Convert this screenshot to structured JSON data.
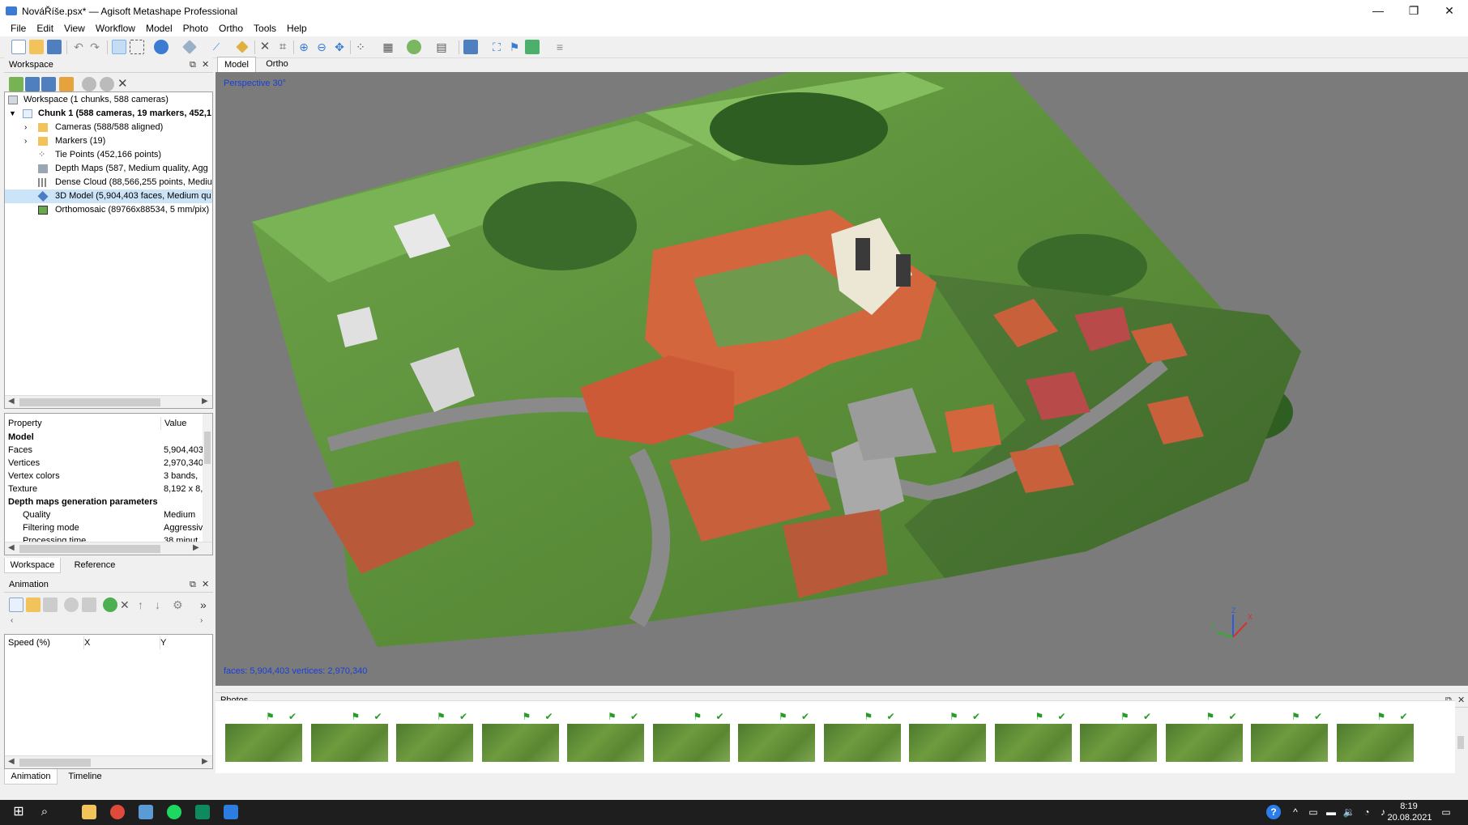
{
  "window": {
    "title": "NováŘíše.psx* — Agisoft Metashape Professional",
    "minimize": "—",
    "maximize": "❐",
    "close": "✕"
  },
  "menu": [
    "File",
    "Edit",
    "View",
    "Workflow",
    "Model",
    "Photo",
    "Ortho",
    "Tools",
    "Help"
  ],
  "workspace": {
    "header": "Workspace",
    "tree": [
      {
        "label": "Workspace (1 chunks, 588 cameras)",
        "icon": "workspace-icon",
        "indent": 0
      },
      {
        "label": "Chunk 1 (588 cameras, 19 markers, 452,1",
        "icon": "chunk-icon",
        "indent": 1,
        "bold": true
      },
      {
        "label": "Cameras (588/588 aligned)",
        "icon": "folder-icon",
        "indent": 2
      },
      {
        "label": "Markers (19)",
        "icon": "folder-icon",
        "indent": 2
      },
      {
        "label": "Tie Points (452,166 points)",
        "icon": "tie-points-icon",
        "indent": 2
      },
      {
        "label": "Depth Maps (587, Medium quality, Agg",
        "icon": "depth-maps-icon",
        "indent": 2
      },
      {
        "label": "Dense Cloud (88,566,255 points, Mediur",
        "icon": "dense-cloud-icon",
        "indent": 2
      },
      {
        "label": "3D Model (5,904,403 faces, Medium qu",
        "icon": "model-icon",
        "indent": 2,
        "selected": true
      },
      {
        "label": "Orthomosaic (89766x88534, 5 mm/pix)",
        "icon": "orthomosaic-icon",
        "indent": 2
      }
    ]
  },
  "properties": {
    "col_property": "Property",
    "col_value": "Value",
    "rows": [
      {
        "k": "Model",
        "v": "",
        "bold": true
      },
      {
        "k": "Faces",
        "v": "5,904,403"
      },
      {
        "k": "Vertices",
        "v": "2,970,340"
      },
      {
        "k": "Vertex colors",
        "v": "3 bands,"
      },
      {
        "k": "Texture",
        "v": "8,192 x 8,"
      },
      {
        "k": "Depth maps generation parameters",
        "v": "",
        "bold": true
      },
      {
        "k": "Quality",
        "v": "Medium",
        "indent": true
      },
      {
        "k": "Filtering mode",
        "v": "Aggressiv",
        "indent": true
      },
      {
        "k": "Processing time",
        "v": "38 minut",
        "indent": true
      }
    ]
  },
  "left_tabs": {
    "workspace": "Workspace",
    "reference": "Reference"
  },
  "animation": {
    "header": "Animation",
    "more": "»",
    "col_speed": "Speed (%)",
    "col_x": "X",
    "col_y": "Y"
  },
  "bottom_tabs": {
    "animation": "Animation",
    "timeline": "Timeline"
  },
  "view_tabs": {
    "model": "Model",
    "ortho": "Ortho"
  },
  "viewport": {
    "perspective": "Perspective 30°",
    "stats": "faces: 5,904,403 vertices: 2,970,340",
    "axis_x": "X",
    "axis_y": "Y",
    "axis_z": "Z"
  },
  "photos": {
    "header": "Photos",
    "thumb_count": 14
  },
  "clock": {
    "time": "8:19",
    "date": "20.08.2021"
  }
}
